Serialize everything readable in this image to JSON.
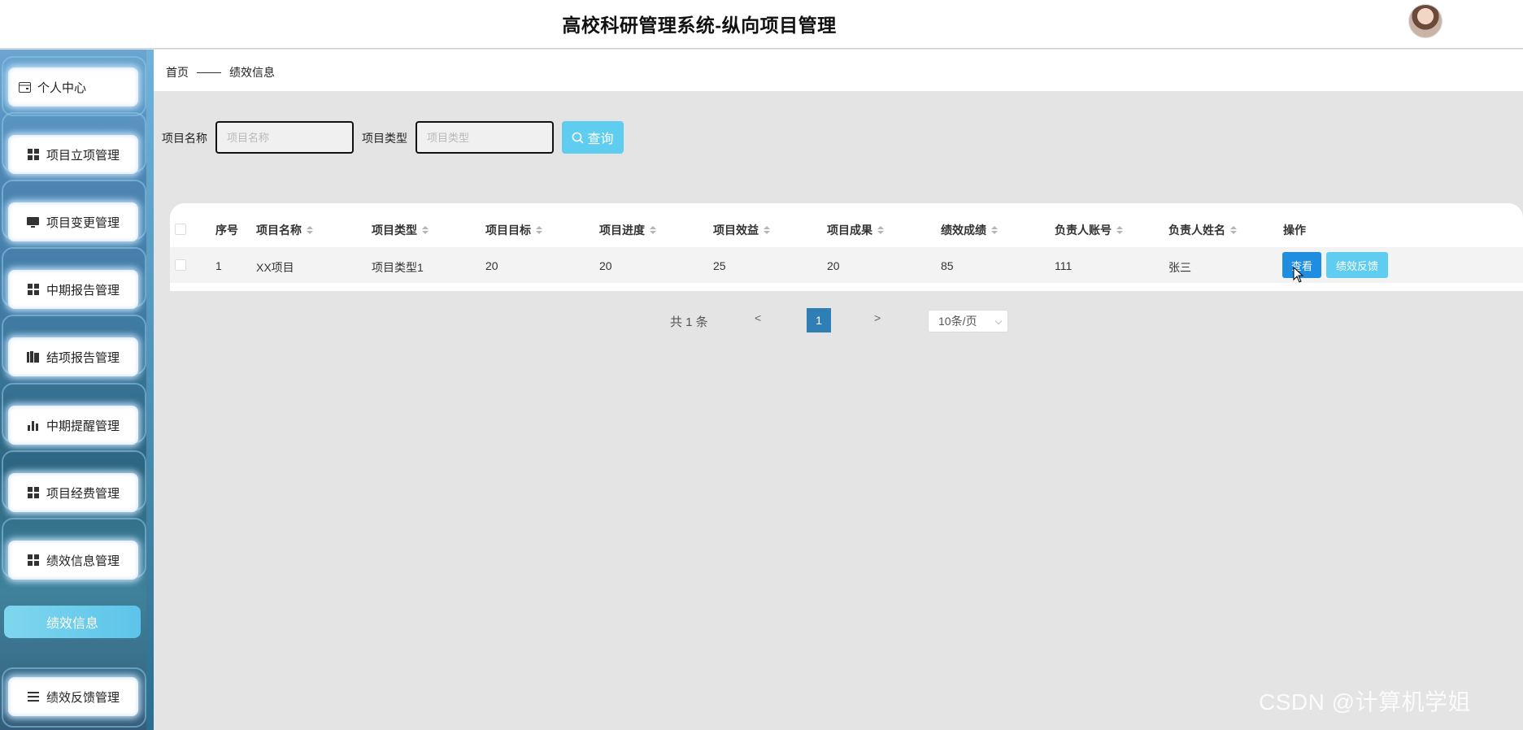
{
  "header": {
    "title": "高校科研管理系统-纵向项目管理"
  },
  "sidebar": {
    "items": [
      {
        "label": "个人中心",
        "icon": "id-card-icon"
      },
      {
        "label": "项目立项管理",
        "icon": "grid-icon"
      },
      {
        "label": "项目变更管理",
        "icon": "monitor-icon"
      },
      {
        "label": "中期报告管理",
        "icon": "grid-icon"
      },
      {
        "label": "结项报告管理",
        "icon": "book-icon"
      },
      {
        "label": "中期提醒管理",
        "icon": "bar-chart-icon"
      },
      {
        "label": "项目经费管理",
        "icon": "grid-icon"
      },
      {
        "label": "绩效信息管理",
        "icon": "grid-icon"
      },
      {
        "label": "绩效反馈管理",
        "icon": "list-icon"
      }
    ],
    "active_sub": "绩效信息"
  },
  "breadcrumb": {
    "home": "首页",
    "current": "绩效信息"
  },
  "search": {
    "name_label": "项目名称",
    "name_placeholder": "项目名称",
    "type_label": "项目类型",
    "type_placeholder": "项目类型",
    "button": "查询"
  },
  "table": {
    "columns": [
      "序号",
      "项目名称",
      "项目类型",
      "项目目标",
      "项目进度",
      "项目效益",
      "项目成果",
      "绩效成绩",
      "负责人账号",
      "负责人姓名",
      "操作"
    ],
    "rows": [
      {
        "index": "1",
        "name": "XX项目",
        "type": "项目类型1",
        "goal": "20",
        "progress": "20",
        "benefit": "25",
        "result": "20",
        "score": "85",
        "account": "111",
        "person": "张三"
      }
    ],
    "actions": {
      "view": "查看",
      "feedback": "绩效反馈"
    }
  },
  "pagination": {
    "total": "共 1 条",
    "prev": "<",
    "page": "1",
    "next": ">",
    "page_size": "10条/页"
  },
  "watermark": "CSDN @计算机学姐",
  "colors": {
    "accent": "#5fcdf0",
    "primary": "#1f8de0",
    "page_active": "#2f7fb5"
  }
}
